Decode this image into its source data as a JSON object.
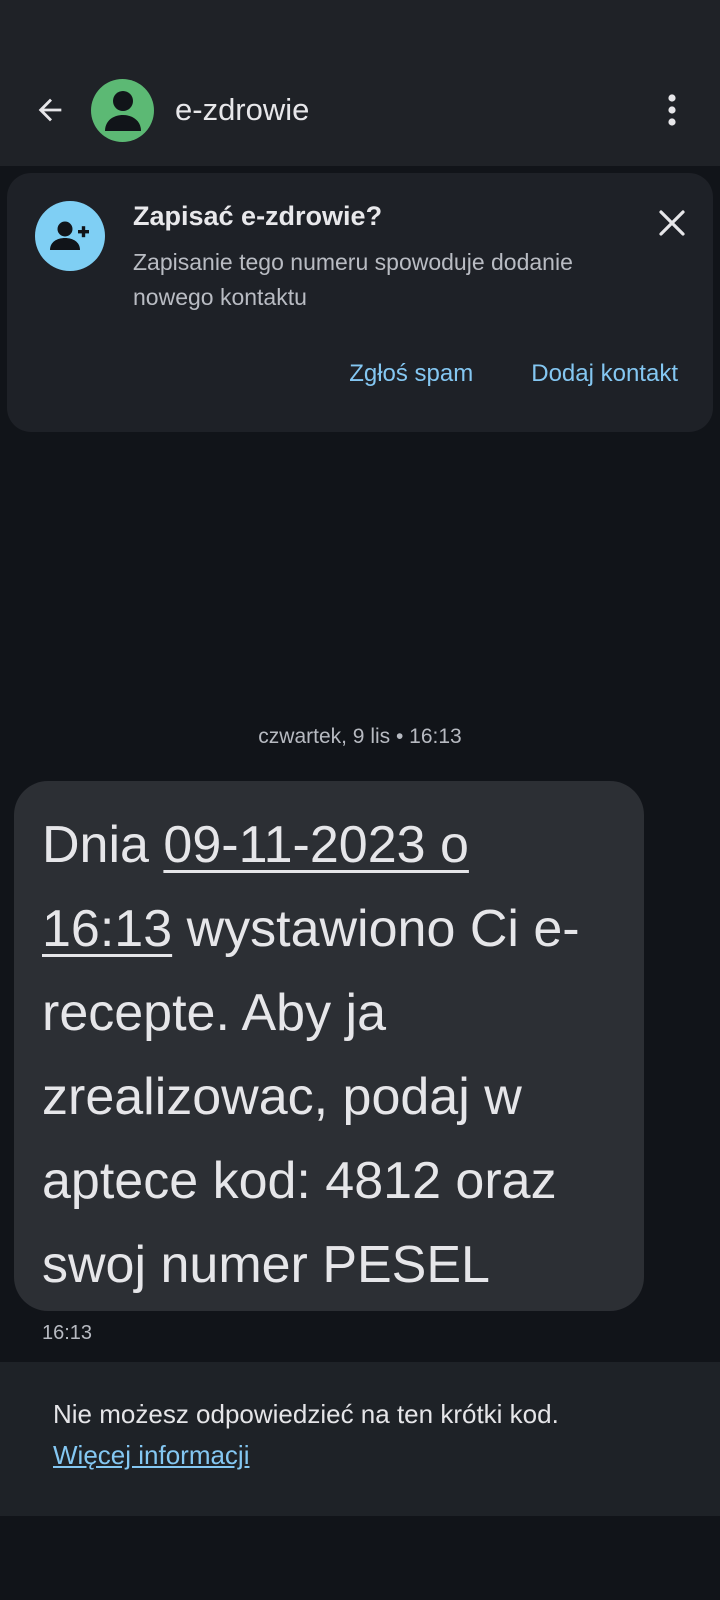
{
  "header": {
    "contact_name": "e-zdrowie",
    "avatar_color": "#5cb974",
    "icons": [
      "back-arrow-icon",
      "person-icon",
      "more-vert-icon"
    ]
  },
  "save_card": {
    "title": "Zapisać e-zdrowie?",
    "body": "Zapisanie tego numeru spowoduje dodanie nowego kontaktu",
    "report_spam_label": "Zgłoś spam",
    "add_contact_label": "Dodaj kontakt",
    "accent_color": "#84c7f2",
    "icons": [
      "add-person-icon",
      "close-icon"
    ]
  },
  "conversation": {
    "date_header": "czwartek, 9 lis • 16:13",
    "message": {
      "link_part_1": "09-11-2023 o",
      "link_part_2": "16:13",
      "prefix": "Dnia ",
      "rest": " wystawiono Ci e-recepte. Aby ja zrealizowac, podaj w aptece kod: 4812 oraz swoj numer PESEL",
      "time": "16:13"
    }
  },
  "footer": {
    "info_text": "Nie możesz odpowiedzieć na ten krótki kod.",
    "info_link": "Więcej informacji"
  }
}
